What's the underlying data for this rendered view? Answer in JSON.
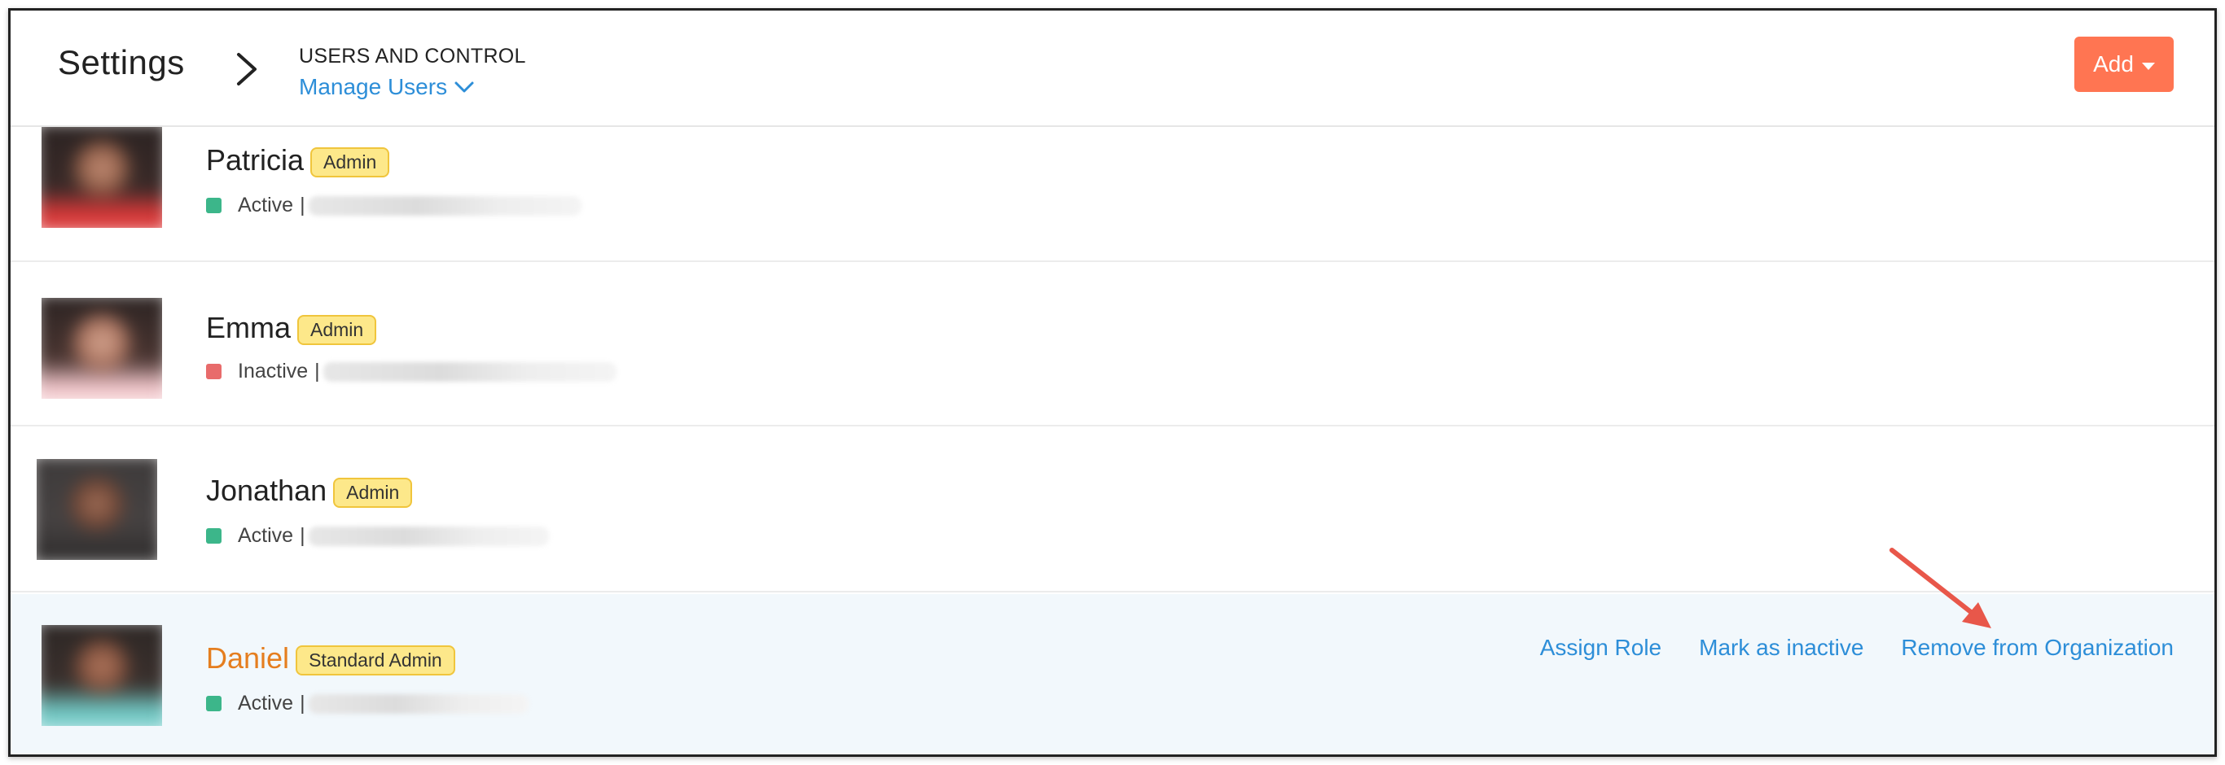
{
  "header": {
    "title": "Settings",
    "breadcrumb_section": "USERS AND CONTROL",
    "breadcrumb_page": "Manage Users",
    "add_button": "Add"
  },
  "users": [
    {
      "name": "Patricia",
      "role": "Admin",
      "status": "Active",
      "separator": "|",
      "status_color": "#3cb68a"
    },
    {
      "name": "Emma",
      "role": "Admin",
      "status": "Inactive",
      "separator": "|",
      "status_color": "#e86b6b"
    },
    {
      "name": "Jonathan",
      "role": "Admin",
      "status": "Active",
      "separator": "|",
      "status_color": "#3cb68a"
    },
    {
      "name": "Daniel",
      "role": "Standard Admin",
      "status": "Active",
      "separator": "|",
      "status_color": "#3cb68a"
    }
  ],
  "row_actions": {
    "assign_role": "Assign Role",
    "mark_inactive": "Mark as inactive",
    "remove": "Remove from Organization"
  },
  "colors": {
    "accent_link": "#2d8ed8",
    "add_button": "#ff7552",
    "badge_bg": "#fde88a",
    "selected_row_bg": "#f2f8fc",
    "highlight_name": "#e57e1f",
    "annotation_arrow": "#e8574a"
  },
  "icons": {
    "breadcrumb_separator": "chevron-right-icon",
    "dropdown": "chevron-down-icon",
    "add_caret": "caret-down-icon",
    "annotation": "annotation-arrow-icon"
  }
}
